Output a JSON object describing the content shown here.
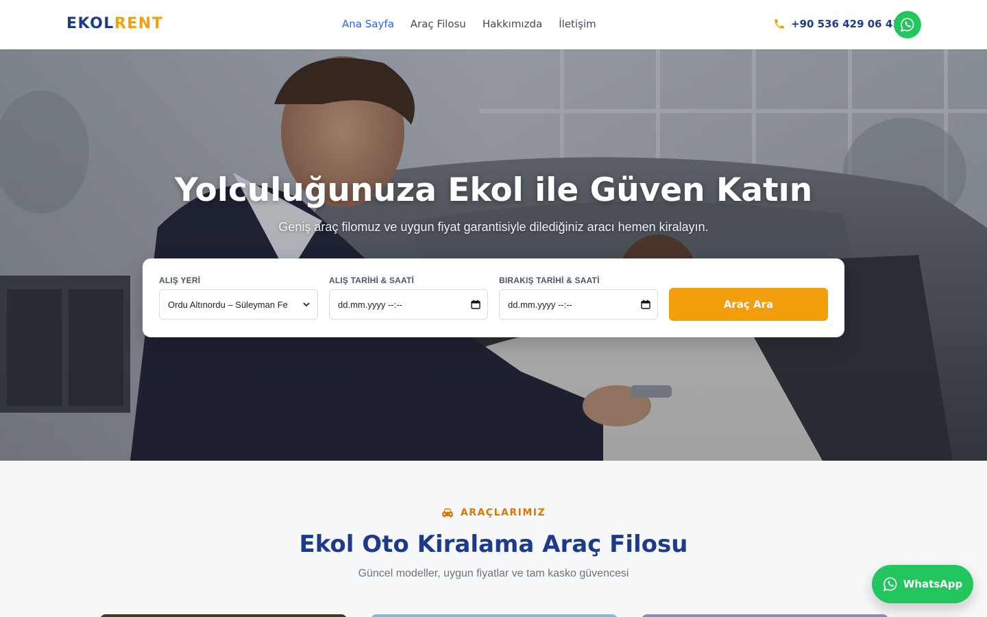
{
  "brand": {
    "part1": "EKOL",
    "part2": "RENT"
  },
  "nav": [
    {
      "label": "Ana Sayfa",
      "active": true
    },
    {
      "label": "Araç Filosu",
      "active": false
    },
    {
      "label": "Hakkımızda",
      "active": false
    },
    {
      "label": "İletişim",
      "active": false
    }
  ],
  "contact": {
    "phone": "+90 536 429 06 41",
    "phone_icon": "phone-icon",
    "whatsapp_icon": "whatsapp-icon"
  },
  "hero": {
    "title": "Yolculuğunuza Ekol ile Güven Katın",
    "subtitle": "Geniş araç filomuz ve uygun fiyat garantisiyle dilediğiniz aracı hemen kiralayın."
  },
  "search": {
    "pickup_location": {
      "label": "ALIŞ YERİ",
      "value": "Ordu Altınordu – Süleyman Fe"
    },
    "pickup_datetime": {
      "label": "ALIŞ TARİHİ & SAATİ",
      "value": "dd.mm.yyyy --:--"
    },
    "dropoff_datetime": {
      "label": "BIRAKIŞ TARİHİ & SAATİ",
      "value": "dd.mm.yyyy --:--"
    },
    "button": "Araç Ara"
  },
  "fleet": {
    "eyebrow": "ARAÇLARIMIZ",
    "title": "Ekol Oto Kiralama Araç Filosu",
    "subtitle": "Güncel modeller, uygun fiyatlar ve tam kasko güvencesi"
  },
  "whatsapp_float": {
    "label": "WhatsApp"
  },
  "colors": {
    "primary": "#1e3a8a",
    "accent": "#f59e0b",
    "link_active": "#2563eb",
    "whatsapp": "#22c55e"
  }
}
